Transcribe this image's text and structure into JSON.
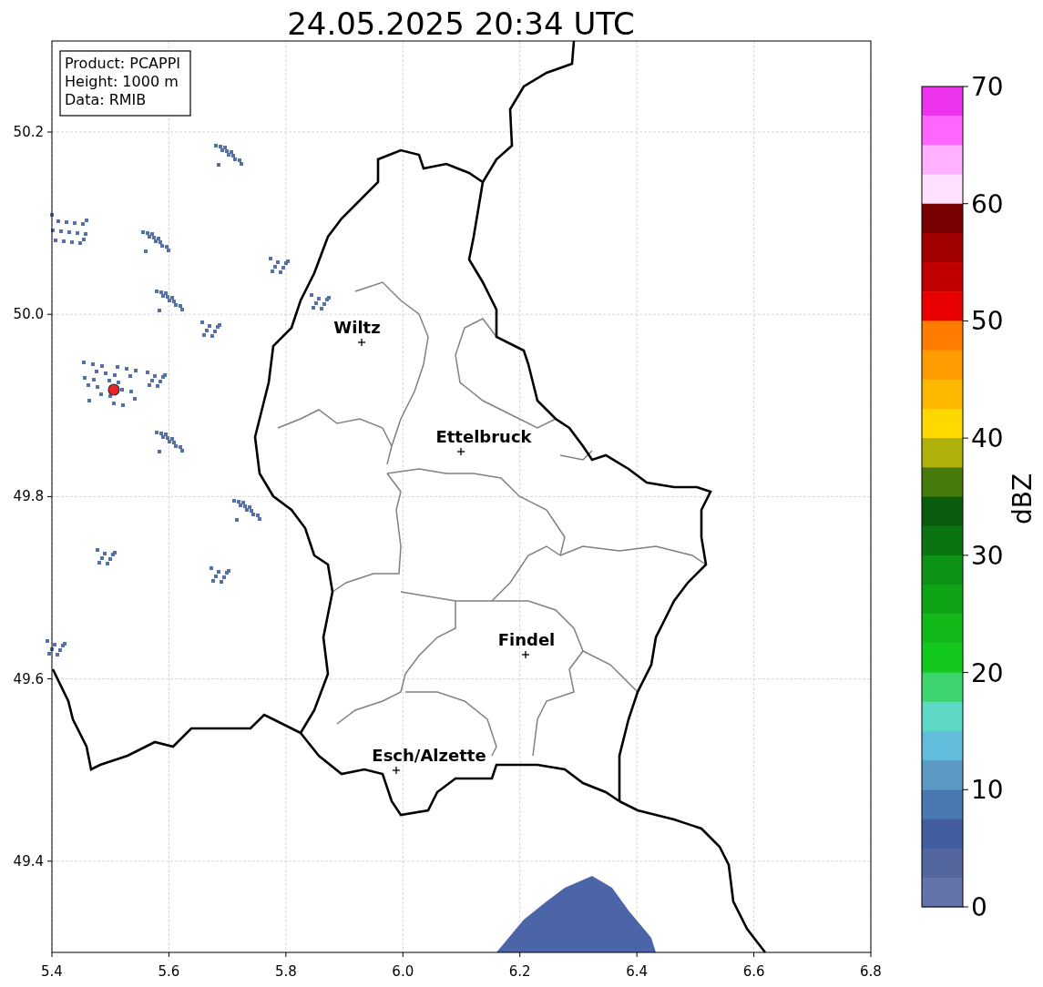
{
  "figure": {
    "title": "24.05.2025 20:34 UTC",
    "legend_lines": [
      "Product: PCAPPI",
      "Height: 1000 m",
      "Data: RMIB"
    ],
    "x_ticks": [
      "5.4",
      "5.6",
      "5.8",
      "6.0",
      "6.2",
      "6.4",
      "6.6",
      "6.8"
    ],
    "y_ticks": [
      "50.2",
      "50.0",
      "49.8",
      "49.6",
      "49.4"
    ],
    "cities": [
      {
        "name": "Wiltz"
      },
      {
        "name": "Ettelbruck"
      },
      {
        "name": "Findel"
      },
      {
        "name": "Esch/Alzette"
      }
    ]
  },
  "colorbar": {
    "label": "dBZ",
    "ticks": [
      "70",
      "60",
      "50",
      "40",
      "30",
      "20",
      "10",
      "0"
    ],
    "bands": [
      {
        "color": "#ee33ee"
      },
      {
        "color": "#ff66ff"
      },
      {
        "color": "#ffb0ff"
      },
      {
        "color": "#ffe0ff"
      },
      {
        "color": "#780000"
      },
      {
        "color": "#a00000"
      },
      {
        "color": "#c00000"
      },
      {
        "color": "#e80000"
      },
      {
        "color": "#ff7c00"
      },
      {
        "color": "#ff9c00"
      },
      {
        "color": "#ffb800"
      },
      {
        "color": "#ffd800"
      },
      {
        "color": "#b0b00a"
      },
      {
        "color": "#467a0a"
      },
      {
        "color": "#0a5c0c"
      },
      {
        "color": "#0a7410"
      },
      {
        "color": "#0c9214"
      },
      {
        "color": "#0ea416"
      },
      {
        "color": "#10b818"
      },
      {
        "color": "#12c81c"
      },
      {
        "color": "#3ed46e"
      },
      {
        "color": "#5cd8c4"
      },
      {
        "color": "#62bcdc"
      },
      {
        "color": "#5a9ac4"
      },
      {
        "color": "#4a78b0"
      },
      {
        "color": "#435ea0"
      },
      {
        "color": "#53669e"
      },
      {
        "color": "#6474a8"
      }
    ]
  }
}
